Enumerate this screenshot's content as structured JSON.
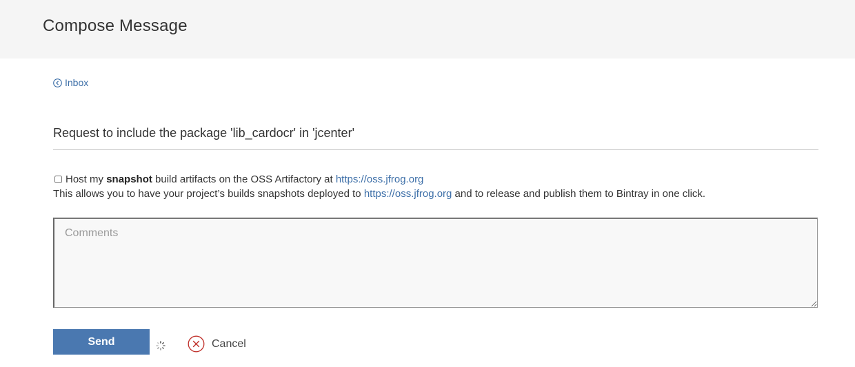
{
  "header": {
    "title": "Compose Message"
  },
  "back": {
    "label": "Inbox",
    "icon": "chevron-left-circle-icon"
  },
  "message": {
    "subject": "Request to include the package 'lib_cardocr' in 'jcenter'"
  },
  "snapshot_option": {
    "checked": false,
    "prefix": "Host my ",
    "bold": "snapshot",
    "suffix": " build artifacts on the OSS Artifactory at ",
    "link": "https://oss.jfrog.org"
  },
  "info": {
    "prefix": "This allows you to have your project’s builds snapshots deployed to ",
    "link": "https://oss.jfrog.org",
    "suffix": " and to release and publish them to Bintray in one click."
  },
  "comments": {
    "placeholder": "Comments",
    "value": ""
  },
  "actions": {
    "send_label": "Send",
    "cancel_label": "Cancel",
    "loading_icon": "spinner-icon",
    "cancel_icon": "close-circle-icon"
  },
  "colors": {
    "link": "#3d6fa8",
    "send_button": "#4a78b0",
    "cancel_icon": "#c0312b",
    "header_bg": "#f5f5f5"
  }
}
